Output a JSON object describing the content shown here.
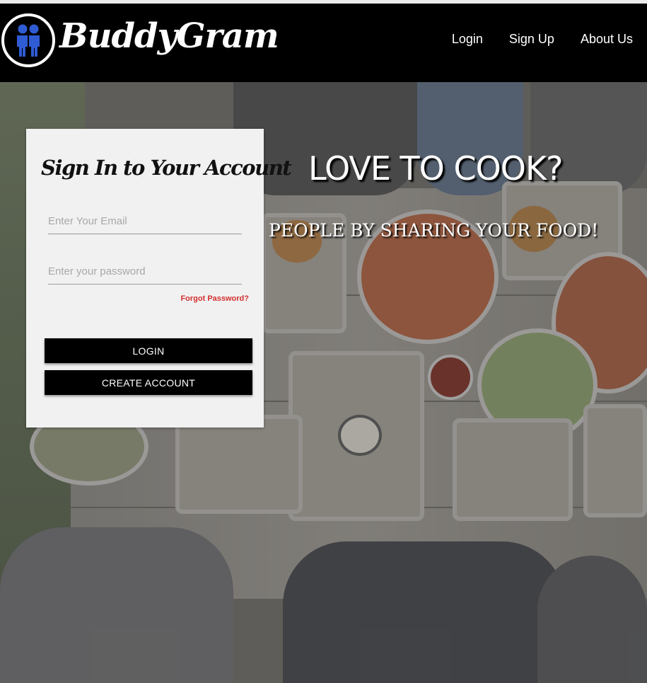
{
  "brand": {
    "name": "BuddyGram",
    "logo_icon": "two-people-icon",
    "accent": "#2f5bd3"
  },
  "nav": {
    "items": [
      {
        "label": "Login"
      },
      {
        "label": "Sign Up"
      },
      {
        "label": "About Us"
      }
    ]
  },
  "hero": {
    "title": "LOVE TO COOK?",
    "subtitle": "PEOPLE BY SHARING YOUR FOOD!"
  },
  "signin": {
    "title": "Sign In to Your Account",
    "email_placeholder": "Enter Your Email",
    "email_value": "",
    "password_placeholder": "Enter your password",
    "password_value": "",
    "forgot_label": "Forgot Password?",
    "login_label": "LOGIN",
    "create_label": "CREATE ACCOUNT"
  },
  "colors": {
    "navbar": "#000000",
    "card": "#f1f1f1",
    "forgot": "#d32f2f",
    "button": "#000000"
  }
}
